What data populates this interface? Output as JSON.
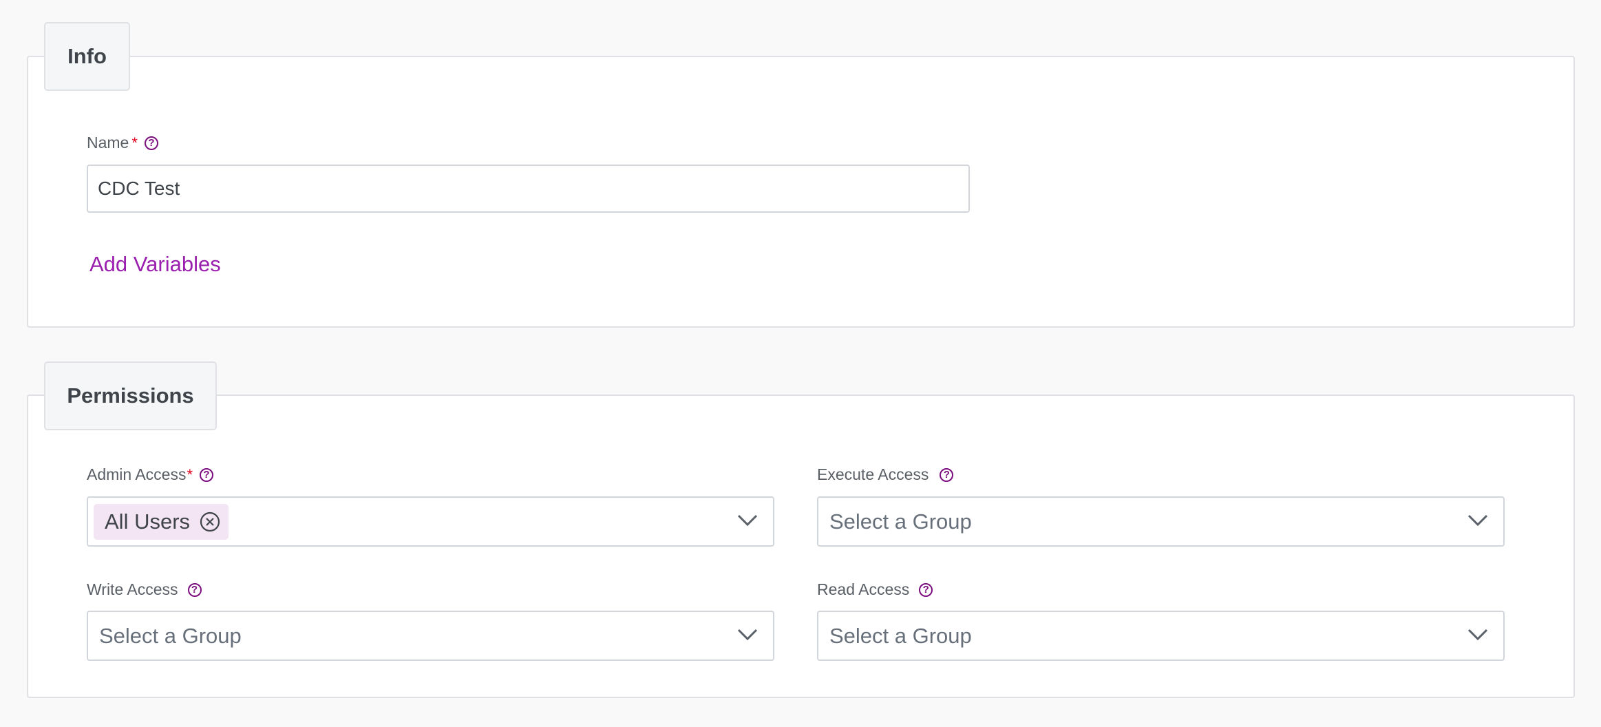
{
  "info": {
    "legend": "Info",
    "name_label": "Name",
    "required_mark": "*",
    "name_value": "CDC Test",
    "add_variables": "Add Variables"
  },
  "permissions": {
    "legend": "Permissions",
    "admin": {
      "label": "Admin Access",
      "required_mark": "*",
      "chip": "All Users"
    },
    "execute": {
      "label": "Execute Access",
      "placeholder": "Select a Group"
    },
    "write": {
      "label": "Write Access",
      "placeholder": "Select a Group"
    },
    "read": {
      "label": "Read Access",
      "placeholder": "Select a Group"
    }
  },
  "help_glyph": "?",
  "colors": {
    "accent": "#7b0d7e",
    "link": "#9b1fae",
    "required": "#e0001b",
    "chip_bg": "#f3e5f4"
  }
}
